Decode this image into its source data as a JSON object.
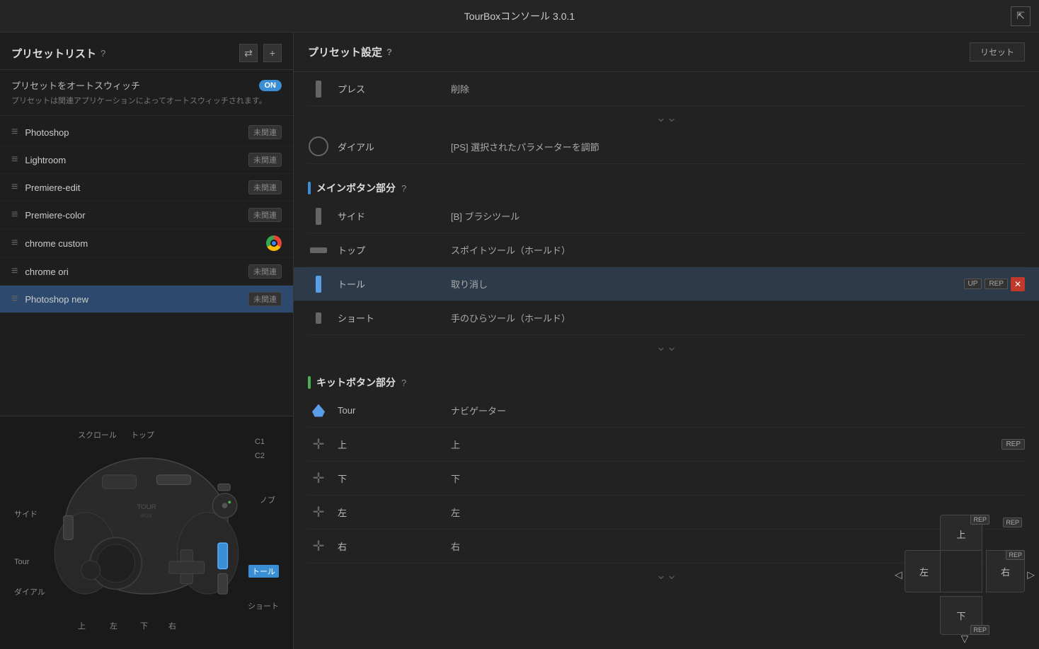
{
  "app": {
    "title": "TourBoxコンソール 3.0.1"
  },
  "left_panel": {
    "preset_list_title": "プリセットリスト",
    "help": "?",
    "auto_switch_label": "プリセットをオートスウィッチ",
    "auto_switch_state": "ON",
    "auto_switch_desc": "プリセットは関連アプリケーションによってオートスウィッチされます。",
    "presets": [
      {
        "name": "Photoshop",
        "badge": "未関連",
        "has_chrome": false,
        "active": false
      },
      {
        "name": "Lightroom",
        "badge": "未関連",
        "has_chrome": false,
        "active": false
      },
      {
        "name": "Premiere-edit",
        "badge": "未関連",
        "has_chrome": false,
        "active": false
      },
      {
        "name": "Premiere-color",
        "badge": "未関連",
        "has_chrome": false,
        "active": false
      },
      {
        "name": "chrome custom",
        "badge": "",
        "has_chrome": true,
        "active": false
      },
      {
        "name": "chrome ori",
        "badge": "未関連",
        "has_chrome": false,
        "active": false
      },
      {
        "name": "Photoshop new",
        "badge": "未関連",
        "has_chrome": false,
        "active": true
      }
    ],
    "controller_labels": {
      "scroll": "スクロール",
      "top": "トップ",
      "c1": "C1",
      "c2": "C2",
      "side": "サイド",
      "knob": "ノブ",
      "tour": "Tour",
      "tall": "トール",
      "dial": "ダイアル",
      "short": "ショート",
      "up": "上",
      "left": "左",
      "down": "下",
      "right": "右"
    }
  },
  "right_panel": {
    "settings_title": "プリセット設定",
    "help": "?",
    "reset_label": "リセット",
    "sections": {
      "main_button": {
        "title": "メインボタン部分",
        "help": "?",
        "color": "blue",
        "rows": [
          {
            "name": "サイド",
            "action": "[B] ブラシツール",
            "active": false,
            "tags": [],
            "icon_type": "rect"
          },
          {
            "name": "トップ",
            "action": "スポイトツール（ホールド）",
            "active": false,
            "tags": [],
            "icon_type": "rect-wide"
          },
          {
            "name": "トール",
            "action": "取り消し",
            "active": true,
            "tags": [
              "UP",
              "REP"
            ],
            "icon_type": "rect"
          },
          {
            "name": "ショート",
            "action": "手のひらツール（ホールド）",
            "active": false,
            "tags": [],
            "icon_type": "rect-short"
          }
        ]
      },
      "kit_button": {
        "title": "キットボタン部分",
        "help": "?",
        "color": "green",
        "rows": [
          {
            "name": "Tour",
            "action": "ナビゲーター",
            "active": false,
            "tags": [],
            "icon_type": "drop"
          },
          {
            "name": "上",
            "action": "上",
            "active": false,
            "tags": [
              "REP"
            ],
            "icon_type": "dpad"
          },
          {
            "name": "下",
            "action": "下",
            "active": false,
            "tags": [],
            "icon_type": "dpad"
          },
          {
            "name": "左",
            "action": "左",
            "active": false,
            "tags": [],
            "icon_type": "dpad"
          },
          {
            "name": "右",
            "action": "右",
            "active": false,
            "tags": [],
            "icon_type": "dpad"
          }
        ]
      }
    },
    "above_rows": [
      {
        "name": "プレス",
        "action": "削除",
        "icon_type": "rect"
      },
      {
        "name": "ダイアル",
        "action": "[PS] 選択されたパラメーターを調節",
        "icon_type": "circle"
      }
    ]
  },
  "dpad_widget": {
    "up_label": "上",
    "down_label": "下",
    "left_label": "左",
    "right_label": "右",
    "up_tag": "REP",
    "right_tag": "REP",
    "down_tag": "REP"
  }
}
